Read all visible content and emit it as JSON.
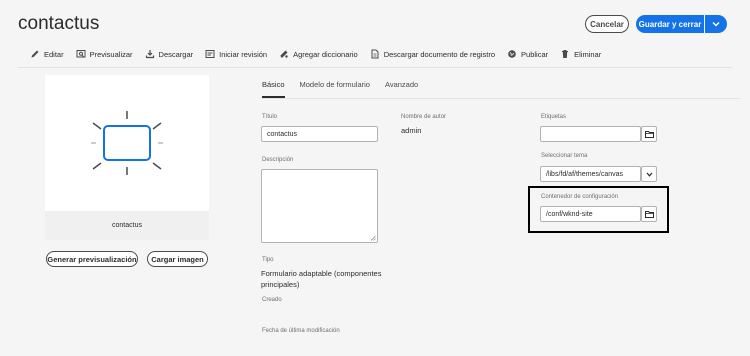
{
  "header": {
    "title": "contactus",
    "cancel_label": "Cancelar",
    "save_label": "Guardar y cerrar"
  },
  "toolbar": {
    "items": [
      {
        "label": "Editar",
        "icon": "pencil-icon"
      },
      {
        "label": "Previsualizar",
        "icon": "preview-icon"
      },
      {
        "label": "Descargar",
        "icon": "download-icon"
      },
      {
        "label": "Iniciar revisión",
        "icon": "review-icon"
      },
      {
        "label": "Agregar diccionario",
        "icon": "dictionary-icon"
      },
      {
        "label": "Descargar documento de registro",
        "icon": "document-icon"
      },
      {
        "label": "Publicar",
        "icon": "globe-icon"
      },
      {
        "label": "Eliminar",
        "icon": "trash-icon"
      }
    ]
  },
  "thumbnail": {
    "caption": "contactus",
    "generate_label": "Generar previsualización",
    "upload_label": "Cargar imagen"
  },
  "tabs": [
    "Básico",
    "Modelo de formulario",
    "Avanzado"
  ],
  "form": {
    "title_label": "Título",
    "title_value": "contactus",
    "description_label": "Descripción",
    "type_label": "Tipo",
    "type_value": "Formulario adaptable (componentes principales)",
    "created_label": "Creado",
    "modified_label": "Fecha de última modificación",
    "author_label": "Nombre de autor",
    "author_value": "admin",
    "tags_label": "Etiquetas",
    "theme_label": "Seleccionar tema",
    "theme_value": "/libs/fd/af/themes/canvas",
    "config_label": "Contenedor de configuración",
    "config_value": "/conf/wknd-site"
  },
  "colors": {
    "accent": "#1473e6",
    "thumb_icon": "#1473e6",
    "highlight_border": "#000000"
  }
}
